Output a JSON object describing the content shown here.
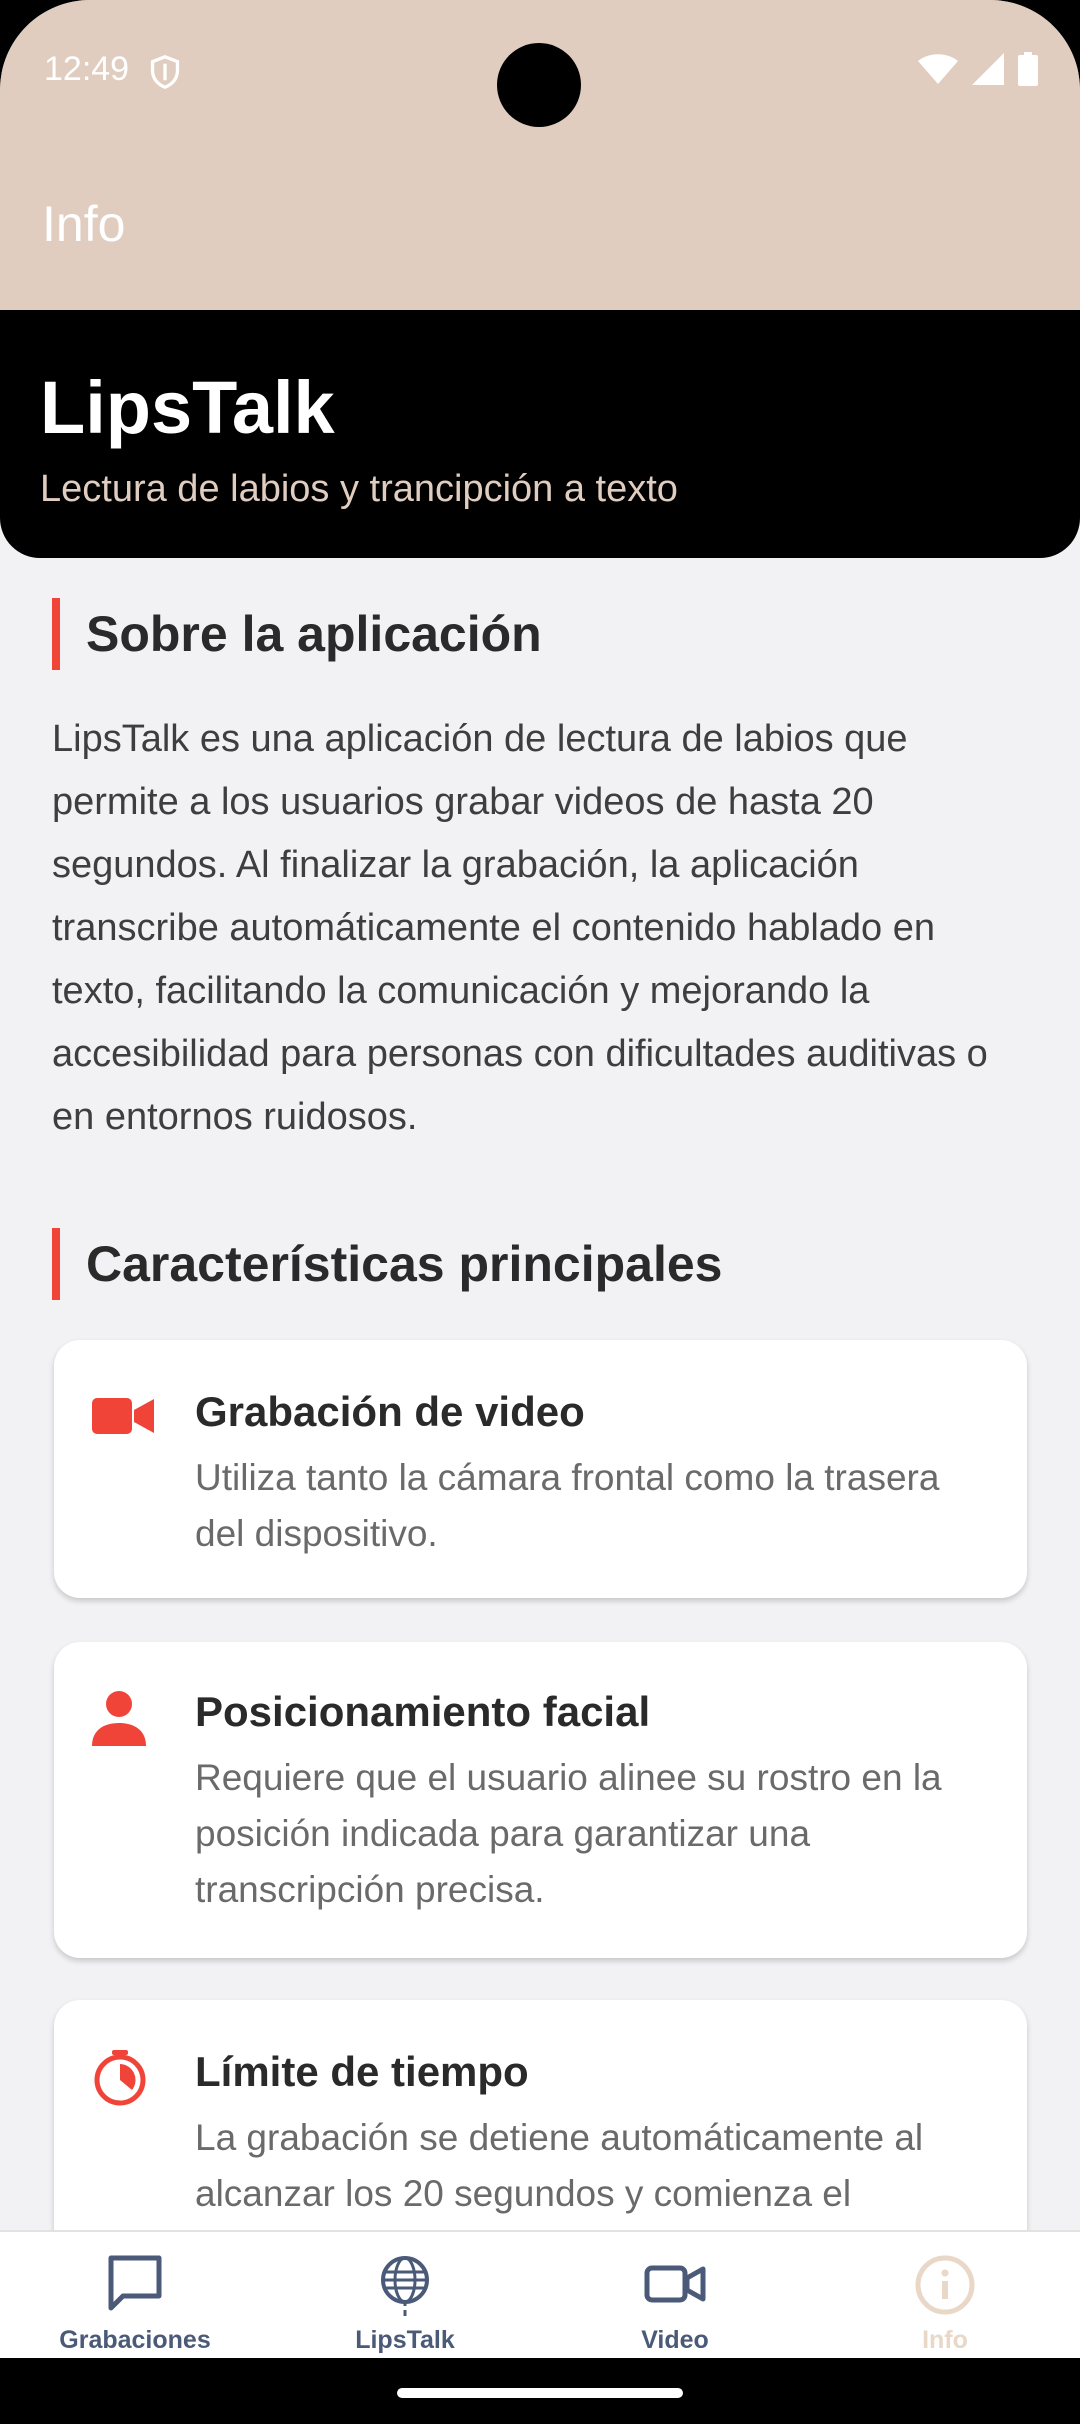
{
  "status_bar": {
    "time": "12:49"
  },
  "app_bar": {
    "title": "Info"
  },
  "hero": {
    "title": "LipsTalk",
    "subtitle": "Lectura de labios y trancipción a texto"
  },
  "about": {
    "heading": "Sobre la aplicación",
    "text": "LipsTalk es una aplicación de lectura de labios que permite a los usuarios grabar videos de hasta 20 segundos. Al finalizar la grabación, la aplicación transcribe automáticamente el contenido hablado en texto, facilitando la comunicación y mejorando la accesibilidad para personas con dificultades auditivas o en entornos ruidosos."
  },
  "features": {
    "heading": "Características principales",
    "items": [
      {
        "icon": "video-camera-icon",
        "title": "Grabación de video",
        "description": "Utiliza tanto la cámara frontal como la trasera del dispositivo."
      },
      {
        "icon": "person-icon",
        "title": "Posicionamiento facial",
        "description": "Requiere que el usuario alinee su rostro en la posición indicada para garantizar una transcripción precisa."
      },
      {
        "icon": "timer-icon",
        "title": "Límite de tiempo",
        "description": "La grabación se detiene automáticamente al alcanzar los 20 segundos y comienza el"
      }
    ]
  },
  "bottom_nav": {
    "items": [
      {
        "label": "Grabaciones",
        "icon": "chat-bubble-icon",
        "active": false
      },
      {
        "label": "LipsTalk",
        "icon": "lips-globe-icon",
        "active": false
      },
      {
        "label": "Video",
        "icon": "video-outline-icon",
        "active": false
      },
      {
        "label": "Info",
        "icon": "info-circle-icon",
        "active": true
      }
    ]
  },
  "colors": {
    "accent": "#f04438",
    "app_bar": "#e0cdbf",
    "nav_inactive": "#4a5a78",
    "nav_active": "#e9d7c7"
  }
}
